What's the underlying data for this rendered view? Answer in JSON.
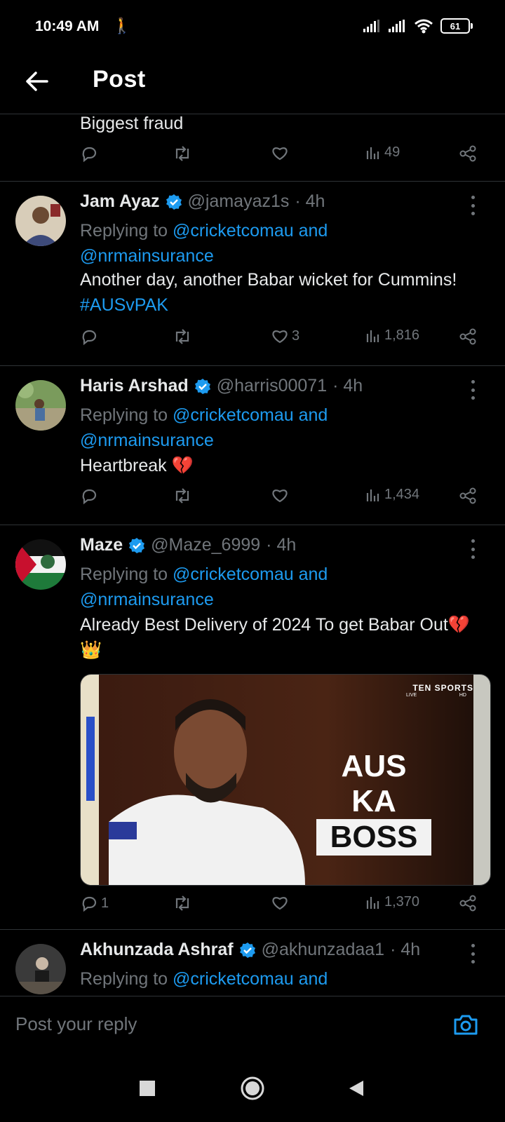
{
  "status_bar": {
    "time": "10:49 AM",
    "battery": "61"
  },
  "header": {
    "title": "Post"
  },
  "top_tweet": {
    "text": "Biggest fraud",
    "views": "49"
  },
  "replies": [
    {
      "name": "Jam Ayaz",
      "handle": "@jamayaz1s",
      "time": "· 4h",
      "replying_prefix": "Replying to ",
      "replying_to_1": "@cricketcomau and",
      "replying_to_2": "@nrmainsurance",
      "text": "Another day, another Babar wicket for Cummins! ",
      "hashtag": "#AUSvPAK",
      "likes": "3",
      "views": "1,816"
    },
    {
      "name": "Haris Arshad",
      "handle": "@harris00071",
      "time": "· 4h",
      "replying_prefix": "Replying to ",
      "replying_to_1": "@cricketcomau and",
      "replying_to_2": "@nrmainsurance",
      "text": "Heartbreak 💔",
      "views": "1,434"
    },
    {
      "name": "Maze",
      "handle": "@Maze_6999",
      "time": "· 4h",
      "replying_prefix": "Replying to ",
      "replying_to_1": "@cricketcomau and",
      "replying_to_2": "@nrmainsurance",
      "text": "Already Best Delivery of 2024 To get Babar Out💔👑",
      "media": {
        "brand": "TEN SPORTS",
        "brand_sub": "LIVE",
        "brand_hd": "HD",
        "line1": "AUS KA",
        "line2": "BOSS"
      },
      "replies": "1",
      "views": "1,370"
    },
    {
      "name": "Akhunzada Ashraf",
      "handle": "@akhunzadaa1",
      "time": "· 4h",
      "replying_prefix": "Replying to ",
      "replying_to_1": "@cricketcomau and"
    }
  ],
  "reply_box": {
    "placeholder": "Post your reply"
  },
  "icons": {
    "back": "arrow-left-icon",
    "verified": "verified-badge-icon",
    "reply": "speech-bubble-icon",
    "retweet": "repost-icon",
    "like": "heart-icon",
    "views": "bar-chart-icon",
    "share": "share-icon",
    "more": "more-vertical-icon",
    "camera": "camera-icon"
  },
  "colors": {
    "accent": "#1d9bf0",
    "muted": "#71767b",
    "background": "#000000",
    "text": "#e7e9ea"
  }
}
